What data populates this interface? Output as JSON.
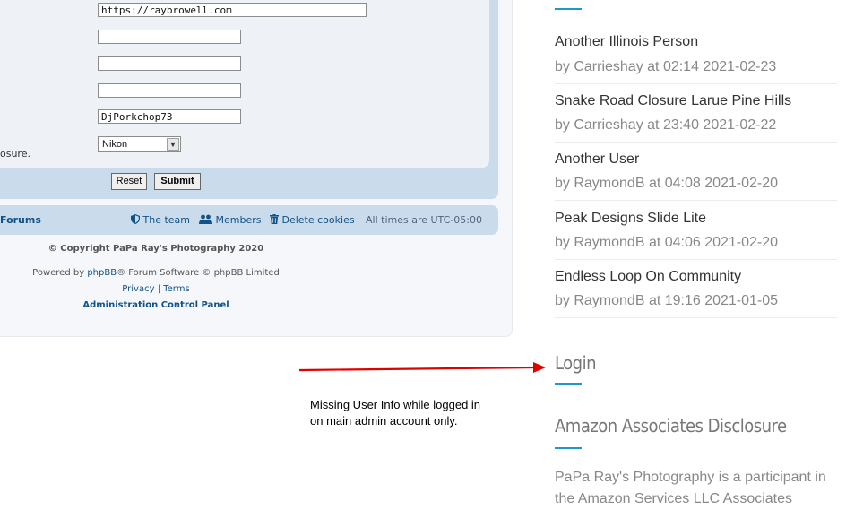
{
  "profile": {
    "fields": [
      {
        "value": "https://raybrowell.com"
      },
      {
        "value": ""
      },
      {
        "value": ""
      },
      {
        "value": ""
      },
      {
        "value": "DjPorkchop73"
      }
    ],
    "camera_select": "Nikon",
    "hint_fragment": "osure.",
    "reset_label": "Reset",
    "submit_label": "Submit"
  },
  "navbar": {
    "forums_label": "Forums",
    "team_label": "The team",
    "members_label": "Members",
    "delete_cookies_label": "Delete cookies",
    "timezone": "All times are UTC-05:00"
  },
  "footer": {
    "copyright": "© Copyright PaPa Ray's Photography 2020",
    "powered_prefix": "Powered by ",
    "powered_link": "phpBB",
    "powered_suffix": "® Forum Software © phpBB Limited",
    "privacy": "Privacy",
    "separator": "|",
    "terms": "Terms",
    "acp": "Administration Control Panel"
  },
  "sidebar": {
    "recent_posts": [
      {
        "title": "Another Illinois Person",
        "meta": "by Carrieshay at 02:14 2021-02-23"
      },
      {
        "title": "Snake Road Closure Larue Pine Hills",
        "meta": "by Carrieshay at 23:40 2021-02-22"
      },
      {
        "title": "Another User",
        "meta": "by RaymondB at 04:08 2021-02-20"
      },
      {
        "title": "Peak Designs Slide Lite",
        "meta": "by RaymondB at 04:06 2021-02-20"
      },
      {
        "title": "Endless Loop On Community",
        "meta": "by RaymondB at 19:16 2021-01-05"
      }
    ],
    "login_title": "Login",
    "disclosure_title": "Amazon Associates Disclosure",
    "disclosure_text": "PaPa Ray's Photography is a participant in the Amazon Services LLC Associates"
  },
  "annotation": {
    "line1": "Missing User Info while logged in",
    "line2": "on main admin account only."
  },
  "colors": {
    "panel_blue": "#cadceb",
    "link_blue": "#105289",
    "accent": "#1e98c8",
    "arrow": "#e00000"
  }
}
